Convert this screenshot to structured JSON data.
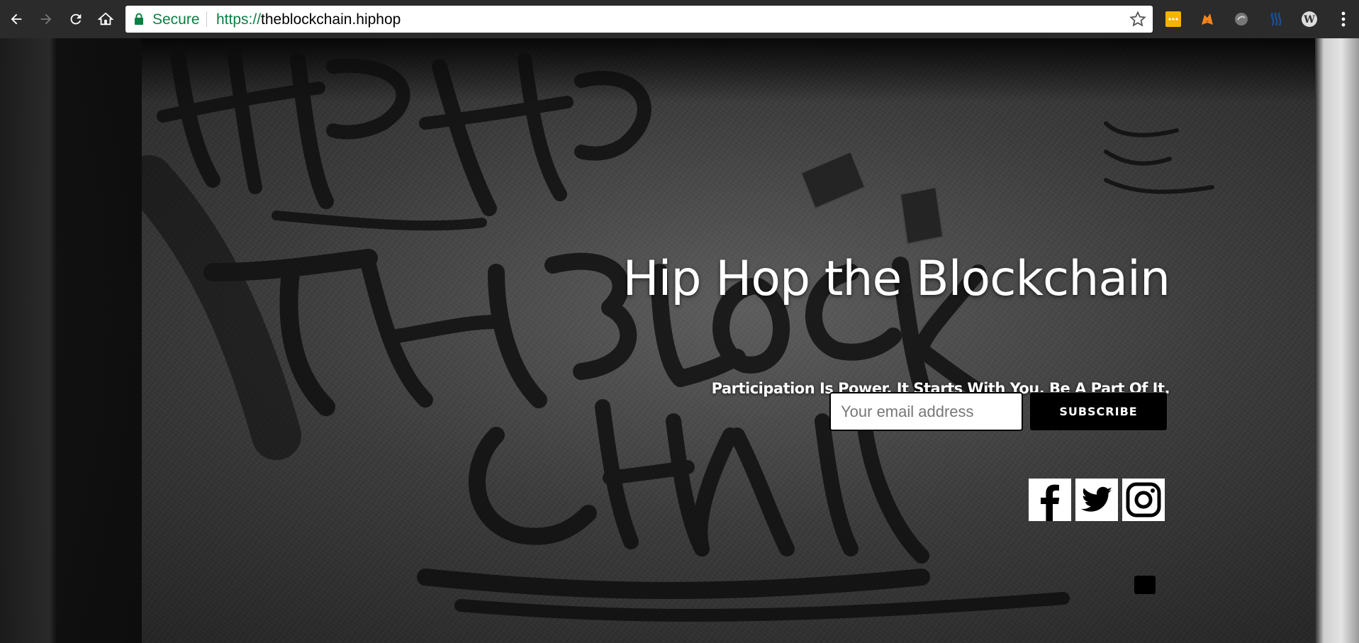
{
  "browser": {
    "secure_label": "Secure",
    "url_scheme": "https://",
    "url_host": "theblockchain.hiphop",
    "extensions": [
      "keep-notes-icon",
      "metamask-icon",
      "hand-icon",
      "steem-icon",
      "wordpress-icon"
    ]
  },
  "colors": {
    "secure_green": "#0b8043",
    "chrome_dark": "#2b2b2b",
    "button_black": "#000000",
    "text_white": "#ffffff"
  },
  "hero": {
    "title": "Hip Hop the Blockchain",
    "subtitle": "Participation Is Power. It Starts With You. Be A Part Of It."
  },
  "form": {
    "email_placeholder": "Your email address",
    "email_value": "",
    "subscribe_label": "SUBSCRIBE"
  },
  "social": [
    "facebook-icon",
    "twitter-icon",
    "instagram-icon"
  ]
}
